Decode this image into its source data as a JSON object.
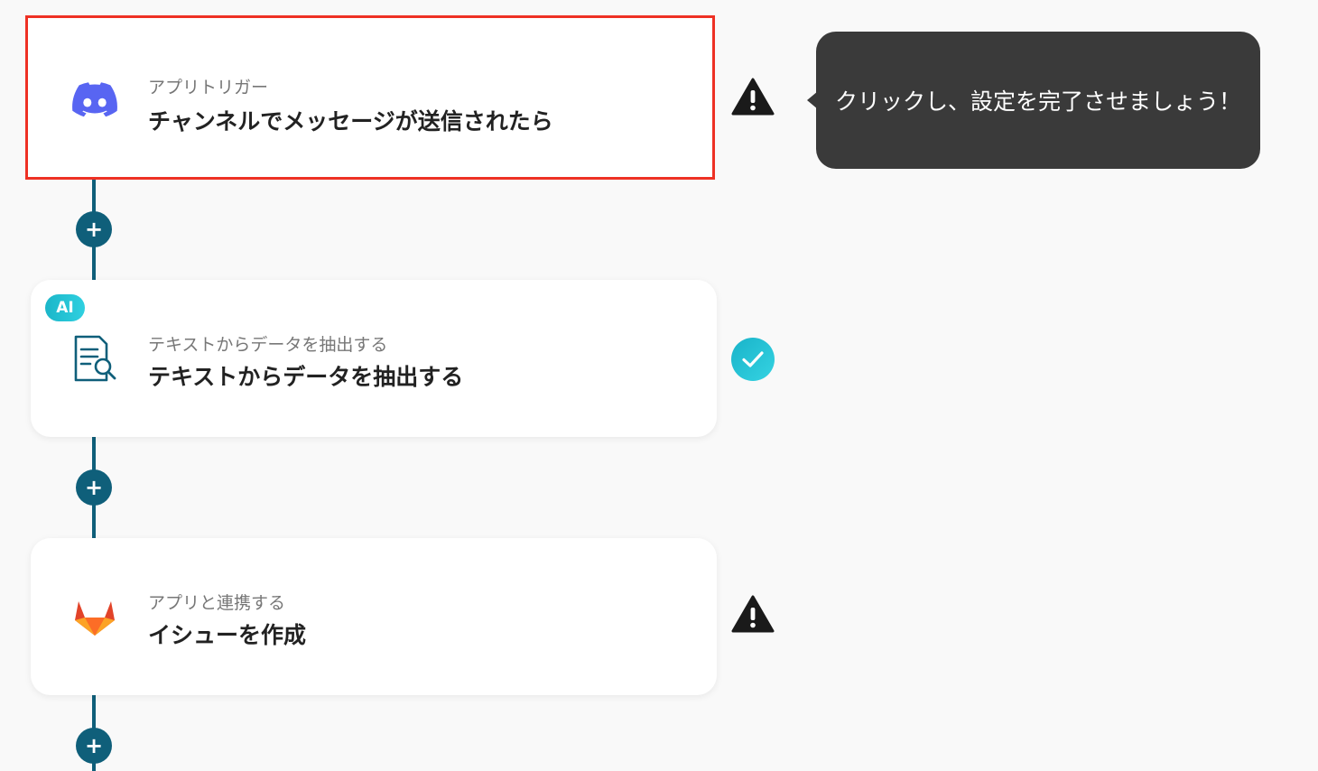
{
  "tooltip": {
    "text": "クリックし、設定を完了させましょう！"
  },
  "steps": [
    {
      "app_icon": "discord-icon",
      "subtitle": "アプリトリガー",
      "title": "チャンネルでメッセージが送信されたら",
      "status": "warning",
      "selected": true
    },
    {
      "app_icon": "document-search-icon",
      "badge": "AI",
      "subtitle": "テキストからデータを抽出する",
      "title": "テキストからデータを抽出する",
      "status": "complete"
    },
    {
      "app_icon": "gitlab-icon",
      "subtitle": "アプリと連携する",
      "title": "イシューを作成",
      "status": "warning"
    }
  ],
  "add_step_label": "+",
  "colors": {
    "connector": "#0f5f7a",
    "selected_border": "#ee3124",
    "complete": "#22c3d6",
    "warning": "#1a1a1a",
    "tooltip_bg": "#3a3a3a"
  }
}
